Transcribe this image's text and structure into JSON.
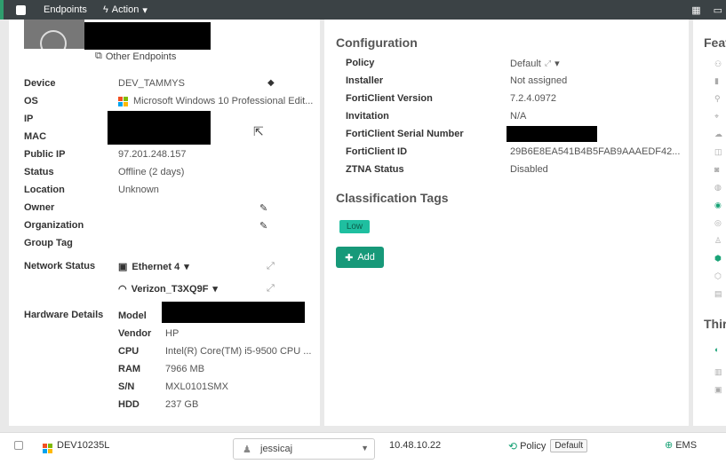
{
  "toolbar": {
    "endpoints_label": "Endpoints",
    "action_label": "Action"
  },
  "device": {
    "other_endpoints_label": "Other Endpoints",
    "rows": {
      "device": {
        "label": "Device",
        "value": "DEV_TAMMYS"
      },
      "os": {
        "label": "OS",
        "value": "Microsoft Windows 10 Professional Edit..."
      },
      "ip": {
        "label": "IP",
        "value": ""
      },
      "mac": {
        "label": "MAC",
        "value": ""
      },
      "public_ip": {
        "label": "Public IP",
        "value": "97.201.248.157"
      },
      "status": {
        "label": "Status",
        "value": "Offline (2 days)"
      },
      "location": {
        "label": "Location",
        "value": "Unknown"
      },
      "owner": {
        "label": "Owner",
        "value": ""
      },
      "organization": {
        "label": "Organization",
        "value": ""
      },
      "group_tag": {
        "label": "Group Tag",
        "value": ""
      }
    },
    "network": {
      "label": "Network Status",
      "items": [
        {
          "name": "Ethernet 4"
        },
        {
          "name": "Verizon_T3XQ9F"
        }
      ]
    },
    "hardware": {
      "label": "Hardware Details",
      "rows": [
        {
          "label": "Model",
          "value": ""
        },
        {
          "label": "Vendor",
          "value": "HP"
        },
        {
          "label": "CPU",
          "value": "Intel(R) Core(TM) i5-9500 CPU ..."
        },
        {
          "label": "RAM",
          "value": "7966 MB"
        },
        {
          "label": "S/N",
          "value": "MXL0101SMX"
        },
        {
          "label": "HDD",
          "value": "237 GB"
        }
      ]
    }
  },
  "configuration": {
    "title": "Configuration",
    "rows": [
      {
        "label": "Policy",
        "value": "Default"
      },
      {
        "label": "Installer",
        "value": "Not assigned"
      },
      {
        "label": "FortiClient Version",
        "value": "7.2.4.0972"
      },
      {
        "label": "Invitation",
        "value": "N/A"
      },
      {
        "label": "FortiClient Serial Number",
        "value": ""
      },
      {
        "label": "FortiClient ID",
        "value": "29B6E8EA541B4B5FAB9AAAEDF42..."
      },
      {
        "label": "ZTNA Status",
        "value": "Disabled"
      }
    ]
  },
  "classification": {
    "title": "Classification Tags",
    "tags": [
      "Low"
    ],
    "add_label": "Add"
  },
  "features": {
    "title": "Feat",
    "third_title": "Thir"
  },
  "bottom_row": {
    "device_name": "DEV10235L",
    "user": "jessicaj",
    "ip": "10.48.10.22",
    "policy_label": "Policy",
    "policy_default": "Default",
    "ems_label": "EMS"
  },
  "colors": {
    "topbar": "#3b4245",
    "accent_green": "#179979",
    "tag_low": "#1fbfa0"
  }
}
